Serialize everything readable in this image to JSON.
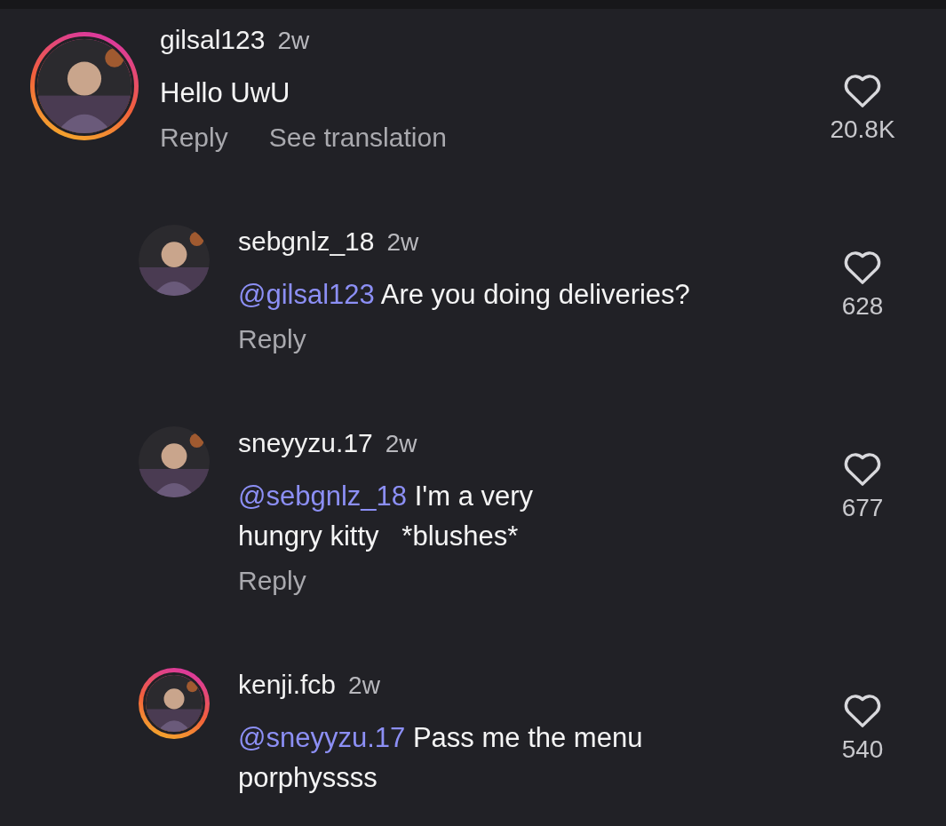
{
  "comments": [
    {
      "username": "gilsal123",
      "time": "2w",
      "body": "Hello UwU",
      "actions": [
        "Reply",
        "See translation"
      ],
      "likes": "20.8K",
      "is_reply": false,
      "story_ring": true
    },
    {
      "username": "sebgnlz_18",
      "time": "2w",
      "mention": "@gilsal123",
      "body": "Are you doing deliveries?",
      "actions": [
        "Reply"
      ],
      "likes": "628",
      "is_reply": true,
      "story_ring": false
    },
    {
      "username": "sneyyzu.17",
      "time": "2w",
      "mention": "@sebgnlz_18",
      "body": "I'm a very\nhungry kitty   *blushes*",
      "actions": [
        "Reply"
      ],
      "likes": "677",
      "is_reply": true,
      "story_ring": false
    },
    {
      "username": "kenji.fcb",
      "time": "2w",
      "mention": "@sneyyzu.17",
      "body": "Pass me the menu\nporphyssss",
      "likes": "540",
      "is_reply": true,
      "story_ring": true
    }
  ]
}
